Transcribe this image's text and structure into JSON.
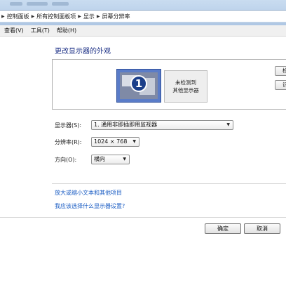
{
  "breadcrumb": {
    "items": [
      "控制面板",
      "所有控制面板项",
      "显示",
      "屏幕分辨率"
    ]
  },
  "menu": {
    "view": "查看(V)",
    "tools": "工具(T)",
    "help": "帮助(H)"
  },
  "main": {
    "title": "更改显示器的外观",
    "monitor1_number": "1",
    "monitor2_line1": "未检测到",
    "monitor2_line2": "其他显示器",
    "detect_button": "检",
    "identify_button": "识",
    "display_label": "显示器(S):",
    "display_value": "1. 通用非即插即用监视器",
    "resolution_label": "分辨率(R):",
    "resolution_value": "1024 × 768",
    "orientation_label": "方向(O):",
    "orientation_value": "横向",
    "link_text_size": "放大或缩小文本和其他项目",
    "link_which_settings": "我应该选择什么显示器设置?"
  },
  "buttons": {
    "ok": "确定",
    "cancel": "取消"
  },
  "colors": {
    "link": "#1c5ec4",
    "title": "#1e3287",
    "address_bar": "#b9d0ea"
  }
}
